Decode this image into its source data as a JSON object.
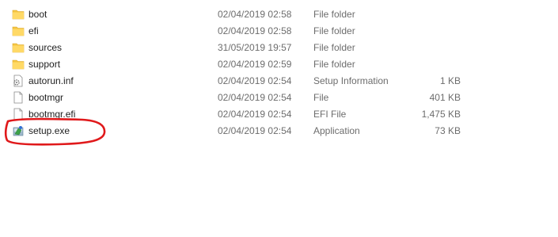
{
  "files": [
    {
      "name": "boot",
      "date": "02/04/2019 02:58",
      "type": "File folder",
      "size": "",
      "icon": "folder-icon"
    },
    {
      "name": "efi",
      "date": "02/04/2019 02:58",
      "type": "File folder",
      "size": "",
      "icon": "folder-icon"
    },
    {
      "name": "sources",
      "date": "31/05/2019 19:57",
      "type": "File folder",
      "size": "",
      "icon": "folder-icon"
    },
    {
      "name": "support",
      "date": "02/04/2019 02:59",
      "type": "File folder",
      "size": "",
      "icon": "folder-icon"
    },
    {
      "name": "autorun.inf",
      "date": "02/04/2019 02:54",
      "type": "Setup Information",
      "size": "1 KB",
      "icon": "setup-info-file-icon"
    },
    {
      "name": "bootmgr",
      "date": "02/04/2019 02:54",
      "type": "File",
      "size": "401 KB",
      "icon": "file-icon"
    },
    {
      "name": "bootmgr.efi",
      "date": "02/04/2019 02:54",
      "type": "EFI File",
      "size": "1,475 KB",
      "icon": "file-icon"
    },
    {
      "name": "setup.exe",
      "date": "02/04/2019 02:54",
      "type": "Application",
      "size": "73 KB",
      "icon": "setup-exe-icon"
    }
  ],
  "colors": {
    "folder": "#f5c542",
    "annotation": "#e0191b",
    "secondary_text": "#6d6d6d"
  }
}
